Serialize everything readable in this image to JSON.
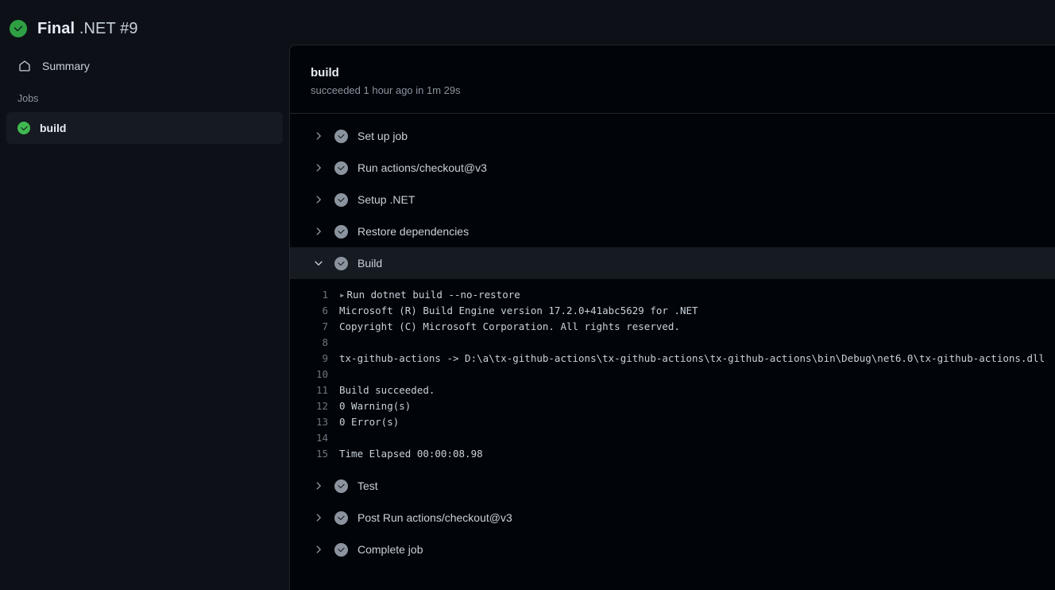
{
  "header": {
    "status_icon": "check-circle-icon",
    "status_color": "#2ea043",
    "title_bold": "Final",
    "title_light": ".NET #9"
  },
  "sidebar": {
    "summary": {
      "icon": "home-icon",
      "label": "Summary"
    },
    "jobs_label": "Jobs",
    "jobs": [
      {
        "label": "build",
        "status": "success",
        "status_color": "#3fb950",
        "selected": true
      }
    ]
  },
  "panel": {
    "title": "build",
    "subtitle": "succeeded 1 hour ago in 1m 29s",
    "steps": [
      {
        "label": "Set up job",
        "expanded": false,
        "chevron": "chevron-right-icon"
      },
      {
        "label": "Run actions/checkout@v3",
        "expanded": false,
        "chevron": "chevron-right-icon"
      },
      {
        "label": "Setup .NET",
        "expanded": false,
        "chevron": "chevron-right-icon"
      },
      {
        "label": "Restore dependencies",
        "expanded": false,
        "chevron": "chevron-right-icon"
      },
      {
        "label": "Build",
        "expanded": true,
        "chevron": "chevron-down-icon"
      },
      {
        "label": "Test",
        "expanded": false,
        "chevron": "chevron-right-icon"
      },
      {
        "label": "Post Run actions/checkout@v3",
        "expanded": false,
        "chevron": "chevron-right-icon"
      },
      {
        "label": "Complete job",
        "expanded": false,
        "chevron": "chevron-right-icon"
      }
    ],
    "log": {
      "step": "Build",
      "lines": [
        {
          "num": "1",
          "marker": "▸",
          "text": "Run dotnet build --no-restore"
        },
        {
          "num": "6",
          "marker": "",
          "text": "Microsoft (R) Build Engine version 17.2.0+41abc5629 for .NET"
        },
        {
          "num": "7",
          "marker": "",
          "text": "Copyright (C) Microsoft Corporation. All rights reserved."
        },
        {
          "num": "8",
          "marker": "",
          "text": ""
        },
        {
          "num": "9",
          "marker": "",
          "text": "  tx-github-actions -> D:\\a\\tx-github-actions\\tx-github-actions\\tx-github-actions\\bin\\Debug\\net6.0\\tx-github-actions.dll"
        },
        {
          "num": "10",
          "marker": "",
          "text": ""
        },
        {
          "num": "11",
          "marker": "",
          "text": "Build succeeded."
        },
        {
          "num": "12",
          "marker": "",
          "text": "    0 Warning(s)"
        },
        {
          "num": "13",
          "marker": "",
          "text": "    0 Error(s)"
        },
        {
          "num": "14",
          "marker": "",
          "text": ""
        },
        {
          "num": "15",
          "marker": "",
          "text": "Time Elapsed 00:00:08.98"
        }
      ]
    }
  }
}
